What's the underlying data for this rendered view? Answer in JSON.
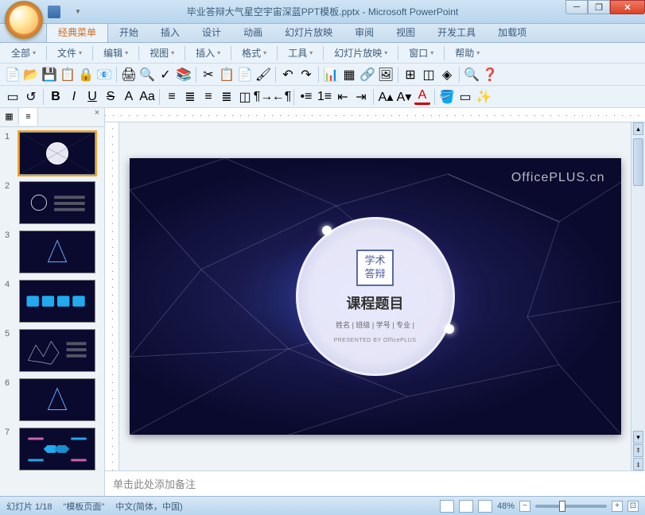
{
  "titlebar": {
    "filename": "毕业答辩大气星空宇宙深蓝PPT模板.pptx",
    "app": "Microsoft PowerPoint"
  },
  "ribbon_tabs": [
    "经典菜单",
    "开始",
    "插入",
    "设计",
    "动画",
    "幻灯片放映",
    "审阅",
    "视图",
    "开发工具",
    "加载项"
  ],
  "active_tab_index": 0,
  "menus": [
    "全部",
    "文件",
    "编辑",
    "视图",
    "插入",
    "格式",
    "工具",
    "幻灯片放映",
    "窗口",
    "帮助"
  ],
  "thumb_tabs": {
    "slides_icon": "▦",
    "outline_icon": "≡"
  },
  "slides": [
    1,
    2,
    3,
    4,
    5,
    6,
    7
  ],
  "selected_slide": 1,
  "slide_content": {
    "brand": "OfficePLUS.cn",
    "badge_line1": "学术",
    "badge_line2": "答辩",
    "course_title": "课程题目",
    "info_line": "姓名 | 班级 | 学号 | 专业 |",
    "presented": "PRESENTED BY OfficePLUS"
  },
  "notes_placeholder": "单击此处添加备注",
  "statusbar": {
    "slide_pos": "幻灯片 1/18",
    "layout": "\"模板页面\"",
    "lang": "中文(简体，中国)",
    "zoom": "48%"
  }
}
